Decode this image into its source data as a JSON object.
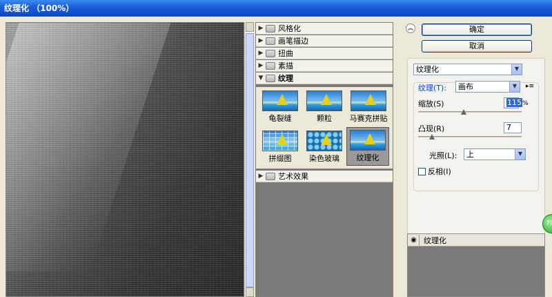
{
  "window": {
    "title": "纹理化 （100%）"
  },
  "gallery": {
    "categories_top": [
      {
        "label": "风格化",
        "expanded": false
      },
      {
        "label": "画笔描边",
        "expanded": false
      },
      {
        "label": "扭曲",
        "expanded": false
      },
      {
        "label": "素描",
        "expanded": false
      },
      {
        "label": "纹理",
        "expanded": true
      }
    ],
    "filters": [
      {
        "label": "龟裂缝",
        "selected": false
      },
      {
        "label": "颗粒",
        "selected": false
      },
      {
        "label": "马赛克拼贴",
        "selected": false
      },
      {
        "label": "拼缀图",
        "selected": false
      },
      {
        "label": "染色玻璃",
        "selected": false
      },
      {
        "label": "纹理化",
        "selected": true
      }
    ],
    "category_bottom": {
      "label": "艺术效果",
      "expanded": false
    }
  },
  "buttons": {
    "ok": "确定",
    "cancel": "取消"
  },
  "settings": {
    "filter_select": "纹理化",
    "texture_label": "纹理(T):",
    "texture_value": "画布",
    "scale_label": "缩放(S)",
    "scale_value": "115",
    "scale_unit": "%",
    "relief_label": "凸现(R)",
    "relief_value": "7",
    "light_label": "光照(L):",
    "light_value": "上",
    "invert_label": "反相(I)",
    "invert_checked": false
  },
  "layers": {
    "items": [
      {
        "name": "纹理化",
        "visible": true
      }
    ]
  },
  "icons": {
    "collapse": "double-chevron-up-icon",
    "folder": "folder-icon",
    "eye": "eye-icon",
    "menu": "panel-menu-icon"
  }
}
